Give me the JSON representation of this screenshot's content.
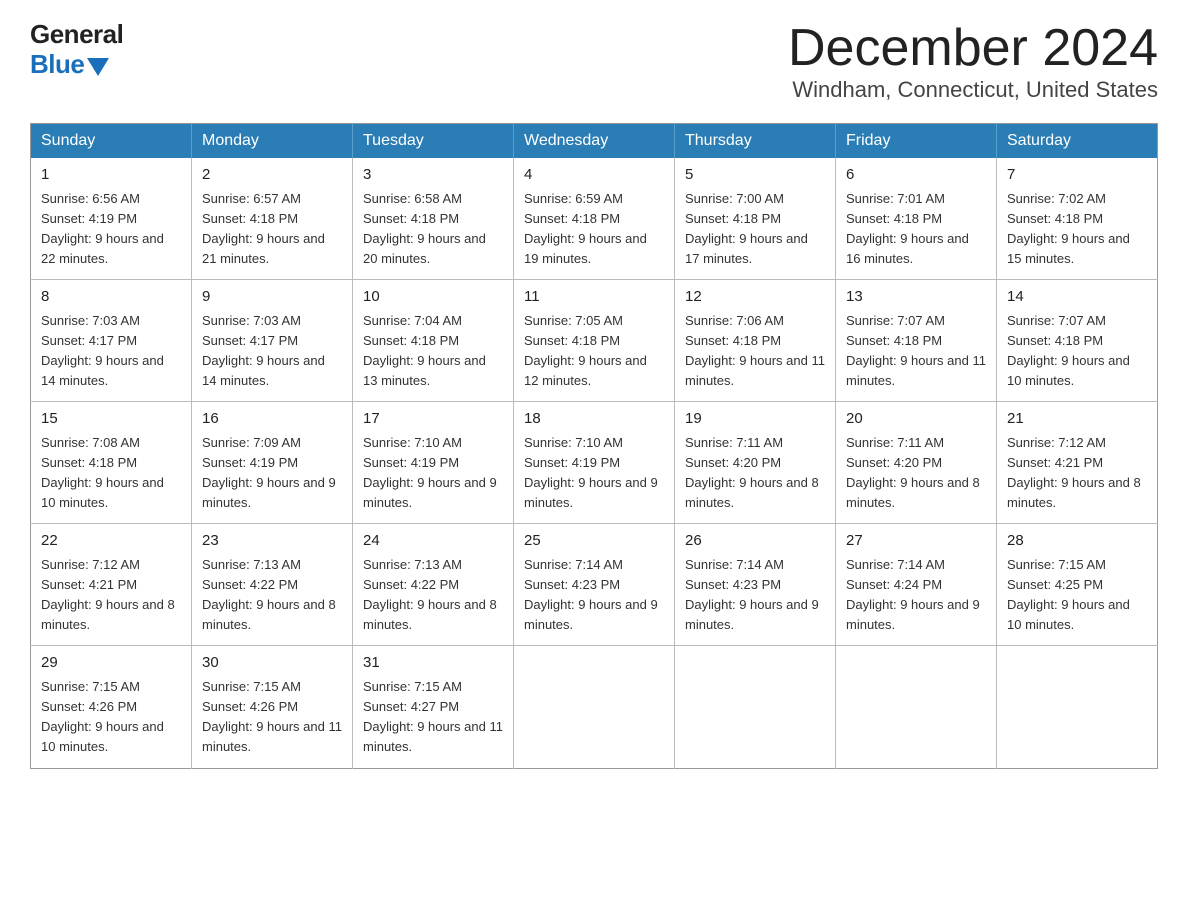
{
  "header": {
    "logo_general": "General",
    "logo_blue": "Blue",
    "month_year": "December 2024",
    "location": "Windham, Connecticut, United States"
  },
  "days_of_week": [
    "Sunday",
    "Monday",
    "Tuesday",
    "Wednesday",
    "Thursday",
    "Friday",
    "Saturday"
  ],
  "weeks": [
    [
      {
        "day": "1",
        "sunrise": "6:56 AM",
        "sunset": "4:19 PM",
        "daylight": "9 hours and 22 minutes."
      },
      {
        "day": "2",
        "sunrise": "6:57 AM",
        "sunset": "4:18 PM",
        "daylight": "9 hours and 21 minutes."
      },
      {
        "day": "3",
        "sunrise": "6:58 AM",
        "sunset": "4:18 PM",
        "daylight": "9 hours and 20 minutes."
      },
      {
        "day": "4",
        "sunrise": "6:59 AM",
        "sunset": "4:18 PM",
        "daylight": "9 hours and 19 minutes."
      },
      {
        "day": "5",
        "sunrise": "7:00 AM",
        "sunset": "4:18 PM",
        "daylight": "9 hours and 17 minutes."
      },
      {
        "day": "6",
        "sunrise": "7:01 AM",
        "sunset": "4:18 PM",
        "daylight": "9 hours and 16 minutes."
      },
      {
        "day": "7",
        "sunrise": "7:02 AM",
        "sunset": "4:18 PM",
        "daylight": "9 hours and 15 minutes."
      }
    ],
    [
      {
        "day": "8",
        "sunrise": "7:03 AM",
        "sunset": "4:17 PM",
        "daylight": "9 hours and 14 minutes."
      },
      {
        "day": "9",
        "sunrise": "7:03 AM",
        "sunset": "4:17 PM",
        "daylight": "9 hours and 14 minutes."
      },
      {
        "day": "10",
        "sunrise": "7:04 AM",
        "sunset": "4:18 PM",
        "daylight": "9 hours and 13 minutes."
      },
      {
        "day": "11",
        "sunrise": "7:05 AM",
        "sunset": "4:18 PM",
        "daylight": "9 hours and 12 minutes."
      },
      {
        "day": "12",
        "sunrise": "7:06 AM",
        "sunset": "4:18 PM",
        "daylight": "9 hours and 11 minutes."
      },
      {
        "day": "13",
        "sunrise": "7:07 AM",
        "sunset": "4:18 PM",
        "daylight": "9 hours and 11 minutes."
      },
      {
        "day": "14",
        "sunrise": "7:07 AM",
        "sunset": "4:18 PM",
        "daylight": "9 hours and 10 minutes."
      }
    ],
    [
      {
        "day": "15",
        "sunrise": "7:08 AM",
        "sunset": "4:18 PM",
        "daylight": "9 hours and 10 minutes."
      },
      {
        "day": "16",
        "sunrise": "7:09 AM",
        "sunset": "4:19 PM",
        "daylight": "9 hours and 9 minutes."
      },
      {
        "day": "17",
        "sunrise": "7:10 AM",
        "sunset": "4:19 PM",
        "daylight": "9 hours and 9 minutes."
      },
      {
        "day": "18",
        "sunrise": "7:10 AM",
        "sunset": "4:19 PM",
        "daylight": "9 hours and 9 minutes."
      },
      {
        "day": "19",
        "sunrise": "7:11 AM",
        "sunset": "4:20 PM",
        "daylight": "9 hours and 8 minutes."
      },
      {
        "day": "20",
        "sunrise": "7:11 AM",
        "sunset": "4:20 PM",
        "daylight": "9 hours and 8 minutes."
      },
      {
        "day": "21",
        "sunrise": "7:12 AM",
        "sunset": "4:21 PM",
        "daylight": "9 hours and 8 minutes."
      }
    ],
    [
      {
        "day": "22",
        "sunrise": "7:12 AM",
        "sunset": "4:21 PM",
        "daylight": "9 hours and 8 minutes."
      },
      {
        "day": "23",
        "sunrise": "7:13 AM",
        "sunset": "4:22 PM",
        "daylight": "9 hours and 8 minutes."
      },
      {
        "day": "24",
        "sunrise": "7:13 AM",
        "sunset": "4:22 PM",
        "daylight": "9 hours and 8 minutes."
      },
      {
        "day": "25",
        "sunrise": "7:14 AM",
        "sunset": "4:23 PM",
        "daylight": "9 hours and 9 minutes."
      },
      {
        "day": "26",
        "sunrise": "7:14 AM",
        "sunset": "4:23 PM",
        "daylight": "9 hours and 9 minutes."
      },
      {
        "day": "27",
        "sunrise": "7:14 AM",
        "sunset": "4:24 PM",
        "daylight": "9 hours and 9 minutes."
      },
      {
        "day": "28",
        "sunrise": "7:15 AM",
        "sunset": "4:25 PM",
        "daylight": "9 hours and 10 minutes."
      }
    ],
    [
      {
        "day": "29",
        "sunrise": "7:15 AM",
        "sunset": "4:26 PM",
        "daylight": "9 hours and 10 minutes."
      },
      {
        "day": "30",
        "sunrise": "7:15 AM",
        "sunset": "4:26 PM",
        "daylight": "9 hours and 11 minutes."
      },
      {
        "day": "31",
        "sunrise": "7:15 AM",
        "sunset": "4:27 PM",
        "daylight": "9 hours and 11 minutes."
      },
      null,
      null,
      null,
      null
    ]
  ]
}
